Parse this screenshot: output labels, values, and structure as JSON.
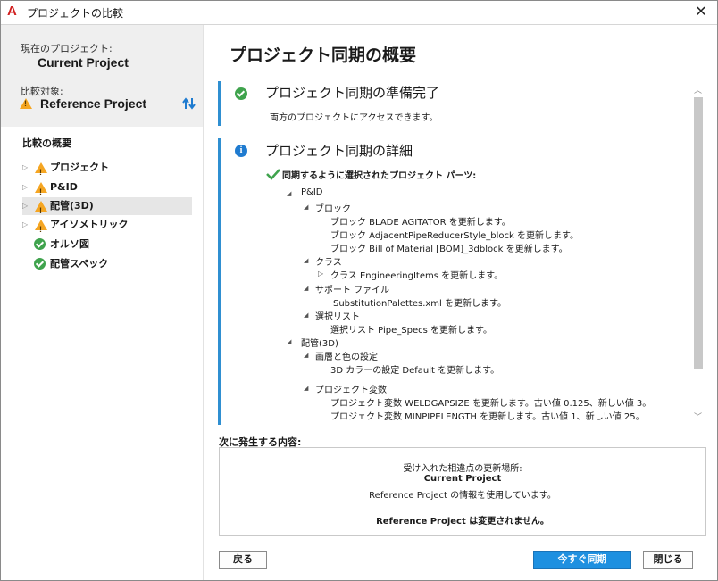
{
  "window": {
    "title": "プロジェクトの比較"
  },
  "sidebar": {
    "current_label": "現在のプロジェクト:",
    "current_value": "Current Project",
    "compare_label": "比較対象:",
    "compare_value": "Reference Project",
    "overview_label": "比較の概要",
    "items": [
      {
        "label": "プロジェクト",
        "icon": "warning-icon"
      },
      {
        "label": "P&ID",
        "icon": "warning-icon"
      },
      {
        "label": "配管(3D)",
        "icon": "warning-icon"
      },
      {
        "label": "アイソメトリック",
        "icon": "warning-icon"
      },
      {
        "label": "オルソ図",
        "icon": "check-circle-icon"
      },
      {
        "label": "配管スペック",
        "icon": "check-circle-icon"
      }
    ]
  },
  "main": {
    "title": "プロジェクト同期の概要",
    "ready": {
      "heading": "プロジェクト同期の準備完了",
      "text": "両方のプロジェクトにアクセスできます。"
    },
    "details": {
      "heading": "プロジェクト同期の詳細",
      "selected_parts": "同期するように選択されたプロジェクト パーツ:",
      "lines": [
        "P&ID",
        "ブロック",
        "ブロック BLADE AGITATOR を更新します。",
        "ブロック AdjacentPipeReducerStyle_block を更新します。",
        "ブロック Bill of Material [BOM]_3dblock を更新します。",
        "クラス",
        "クラス EngineeringItems を更新します。",
        "サポート ファイル",
        "SubstitutionPalettes.xml を更新します。",
        "選択リスト",
        "選択リスト Pipe_Specs を更新します。",
        "配管(3D)",
        "画層と色の設定",
        "3D カラーの設定 Default を更新します。",
        "プロジェクト変数",
        "プロジェクト変数 WELDGAPSIZE を更新します。古い値 0.125、新しい値 3。",
        "プロジェクト変数 MINPIPELENGTH を更新します。古い値 1、新しい値 25。"
      ]
    },
    "next": {
      "label": "次に発生する内容:",
      "line1": "受け入れた相違点の更新場所:",
      "line2": "Current Project",
      "line3": "Reference Project の情報を使用しています。",
      "line4": "Reference Project は変更されません。"
    }
  },
  "buttons": {
    "back": "戻る",
    "sync_now": "今すぐ同期",
    "close": "閉じる"
  },
  "colors": {
    "accent": "#1e90e0",
    "ok": "#3fa34d",
    "warning": "#f5a623",
    "info_bar": "#2f8fd1"
  }
}
